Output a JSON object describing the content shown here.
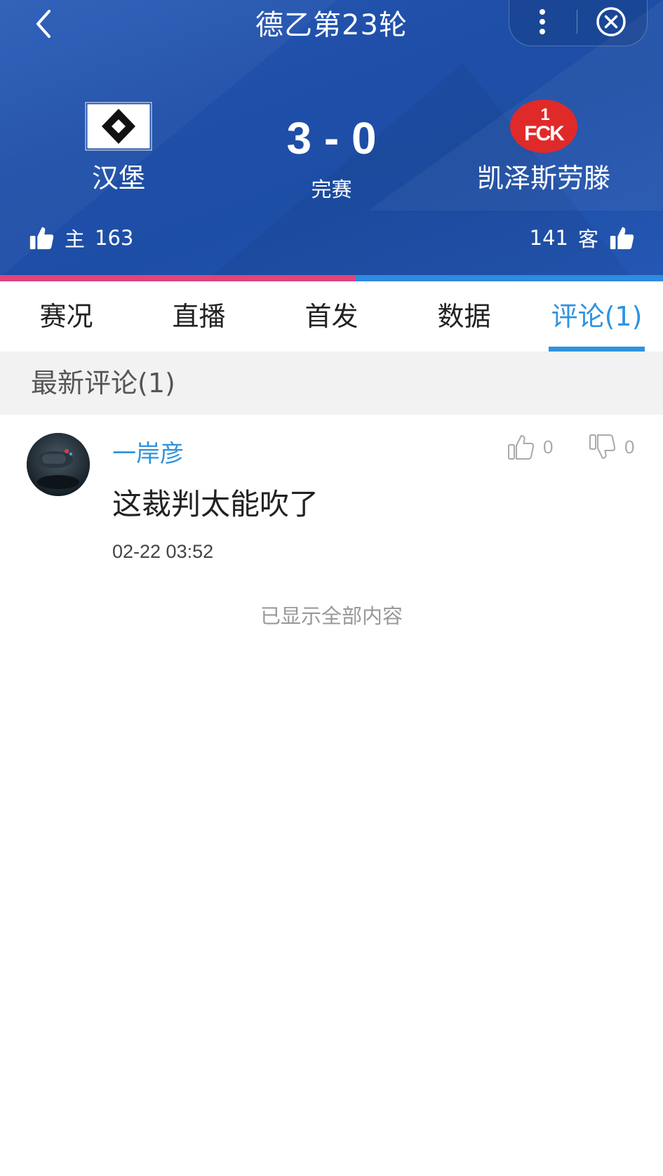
{
  "nav": {
    "title": "德乙第23轮",
    "back_icon": "chevron-left-icon",
    "more_icon": "more-vertical-icon",
    "close_icon": "close-circle-icon"
  },
  "match": {
    "home": {
      "name": "汉堡",
      "logo": "hamburger-sv-logo",
      "side_label": "主",
      "likes": "163"
    },
    "away": {
      "name": "凯泽斯劳滕",
      "logo": "1fc-kaiserslautern-logo",
      "logo_text": "FCK",
      "logo_number": "1",
      "side_label": "客",
      "likes": "141"
    },
    "score": "3 - 0",
    "status": "完赛",
    "home_support_fraction": 0.536,
    "colors": {
      "home": "#e0457b",
      "away": "#2f8ae0",
      "header": "#1f4fa8"
    }
  },
  "tabs": [
    {
      "label": "赛况",
      "active": false
    },
    {
      "label": "直播",
      "active": false
    },
    {
      "label": "首发",
      "active": false
    },
    {
      "label": "数据",
      "active": false
    },
    {
      "label": "评论(1)",
      "active": true
    }
  ],
  "comments_section": {
    "header": "最新评论(1)",
    "items": [
      {
        "username": "一岸彦",
        "text": "这裁判太能吹了",
        "time": "02-22 03:52",
        "likes": "0",
        "dislikes": "0"
      }
    ],
    "end_text": "已显示全部内容"
  },
  "accent_color": "#2f93e0"
}
